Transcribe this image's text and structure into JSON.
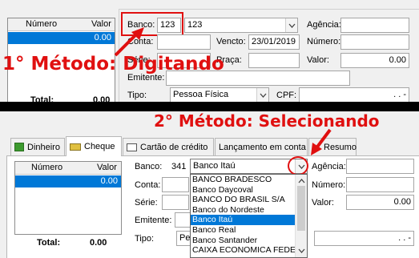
{
  "top_panel": {
    "grid_headers": [
      "Número",
      "Valor"
    ],
    "grid_row_value": "0.00",
    "total_label": "Total:",
    "total_value": "0.00",
    "banco_label": "Banco:",
    "banco_code": "123",
    "banco_name": "123",
    "agencia_label": "Agência:",
    "conta_label": "Conta:",
    "vencto_label": "Vencto:",
    "vencto_value": "23/01/2019",
    "numero_label": "Número:",
    "serie_label": "Série:",
    "praca_label": "Praça:",
    "valor_label": "Valor:",
    "valor_value": "0.00",
    "emitente_label": "Emitente:",
    "tipo_label": "Tipo:",
    "tipo_value": "Pessoa Física",
    "cpf_label": "CPF:",
    "cpf_value": ".   .   -"
  },
  "annotations": {
    "method1": "1° Método: Digitando",
    "method2": "2° Método: Selecionando",
    "color": "#e01010"
  },
  "tabs": [
    {
      "label": "Dinheiro",
      "icon": "money-icon"
    },
    {
      "label": "Cheque",
      "icon": "cheque-icon"
    },
    {
      "label": "Cartão de crédito",
      "icon": "credit-card-icon"
    },
    {
      "label": "Lançamento em conta",
      "icon": ""
    },
    {
      "label": "Resumo",
      "icon": ""
    }
  ],
  "bottom_panel": {
    "grid_headers": [
      "Número",
      "Valor"
    ],
    "grid_row_value": "0.00",
    "total_label": "Total:",
    "total_value": "0.00",
    "banco_label": "Banco:",
    "banco_code": "341",
    "banco_name": "Banco Itaú",
    "agencia_label": "Agência:",
    "conta_label": "Conta:",
    "numero_label": "Número:",
    "serie_label": "Série:",
    "valor_label": "Valor:",
    "valor_value": "0.00",
    "emitente_label": "Emitente:",
    "tipo_label": "Tipo:",
    "tipo_value": "Pess",
    "cpf_value": ".   .   -",
    "bank_options": [
      "BANCO BRADESCO",
      "Banco Daycoval",
      "BANCO DO BRASIL S/A",
      "Banco do Nordeste",
      "Banco Itaú",
      "Banco Real",
      "Banco Santander",
      "CAIXA ECONOMICA FEDERAL"
    ],
    "selected_option": "Banco Itaú"
  }
}
